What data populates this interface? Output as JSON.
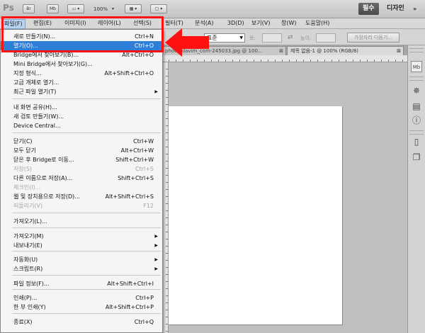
{
  "app": {
    "logo": "Ps",
    "zoom": "100%"
  },
  "toolbar": {
    "bridge_label": "Br",
    "minibridge_label": "Mb"
  },
  "workspaces": {
    "active": "필수",
    "second": "디자인",
    "more": "»"
  },
  "menubar": {
    "items": [
      "파일(F)",
      "편집(E)",
      "이미지(I)",
      "레이어(L)",
      "선택(S)",
      "필터(T)",
      "분석(A)",
      "3D(D)",
      "보기(V)",
      "창(W)",
      "도움말(H)"
    ]
  },
  "options": {
    "style_value": "표준",
    "width_label": "폭:",
    "height_label": "높이:",
    "refine_label": "가장자리 다듬기..."
  },
  "doc_tabs": [
    {
      "label": "photo_davim_com-245033.jpg @ 100...",
      "close": "⊠"
    },
    {
      "label": "제목 없음-1 @ 100% (RGB/8)",
      "close": "⊠"
    }
  ],
  "file_menu": {
    "items": [
      {
        "label": "새로 만들기(N)...",
        "shortcut": "Ctrl+N",
        "disabled": false
      },
      {
        "label": "열기(O)...",
        "shortcut": "Ctrl+O",
        "disabled": false,
        "highlighted": true
      },
      {
        "label": "Bridge에서 찾아보기(B)...",
        "shortcut": "Alt+Ctrl+O",
        "disabled": false
      },
      {
        "label": "Mini Bridge에서 찾아보기(G)...",
        "shortcut": "",
        "disabled": false
      },
      {
        "label": "지정 형식...",
        "shortcut": "Alt+Shift+Ctrl+O",
        "disabled": false
      },
      {
        "label": "고급 개체로 열기...",
        "shortcut": "",
        "disabled": false
      },
      {
        "label": "최근 파일 열기(T)",
        "shortcut": "",
        "disabled": false,
        "submenu": true
      },
      {
        "label": "내 화면 공유(H)...",
        "shortcut": "",
        "disabled": false
      },
      {
        "label": "새 검토 만들기(W)...",
        "shortcut": "",
        "disabled": false
      },
      {
        "label": "Device Central...",
        "shortcut": "",
        "disabled": false
      },
      {
        "label": "닫기(C)",
        "shortcut": "Ctrl+W",
        "disabled": false
      },
      {
        "label": "모두 닫기",
        "shortcut": "Alt+Ctrl+W",
        "disabled": false
      },
      {
        "label": "닫은 후 Bridge로 이동...",
        "shortcut": "Shift+Ctrl+W",
        "disabled": false
      },
      {
        "label": "저장(S)",
        "shortcut": "Ctrl+S",
        "disabled": true
      },
      {
        "label": "다른 이름으로 저장(A)...",
        "shortcut": "Shift+Ctrl+S",
        "disabled": false
      },
      {
        "label": "체크인(I)...",
        "shortcut": "",
        "disabled": true
      },
      {
        "label": "웹 및 장치용으로 저장(D)...",
        "shortcut": "Alt+Shift+Ctrl+S",
        "disabled": false
      },
      {
        "label": "되돌리기(V)",
        "shortcut": "F12",
        "disabled": true
      },
      {
        "label": "가져오기(L)...",
        "shortcut": "",
        "disabled": false
      },
      {
        "label": "가져오기(M)",
        "shortcut": "",
        "disabled": false,
        "submenu": true
      },
      {
        "label": "내보내기(E)",
        "shortcut": "",
        "disabled": false,
        "submenu": true
      },
      {
        "label": "자동화(U)",
        "shortcut": "",
        "disabled": false,
        "submenu": true
      },
      {
        "label": "스크립트(R)",
        "shortcut": "",
        "disabled": false,
        "submenu": true
      },
      {
        "label": "파일 정보(F)...",
        "shortcut": "Alt+Shift+Ctrl+I",
        "disabled": false
      },
      {
        "label": "인쇄(P)...",
        "shortcut": "Ctrl+P",
        "disabled": false
      },
      {
        "label": "한 부 인쇄(Y)",
        "shortcut": "Alt+Shift+Ctrl+P",
        "disabled": false
      },
      {
        "label": "종료(X)",
        "shortcut": "Ctrl+Q",
        "disabled": false
      }
    ]
  },
  "colors": {
    "highlight": "#2f7fd8",
    "annotation": "#ff1111"
  },
  "icons": {
    "right_panel": [
      "mb-icon",
      "asterisk-tool-icon",
      "histogram-icon",
      "info-icon",
      "document-icon",
      "layers-icon"
    ]
  }
}
